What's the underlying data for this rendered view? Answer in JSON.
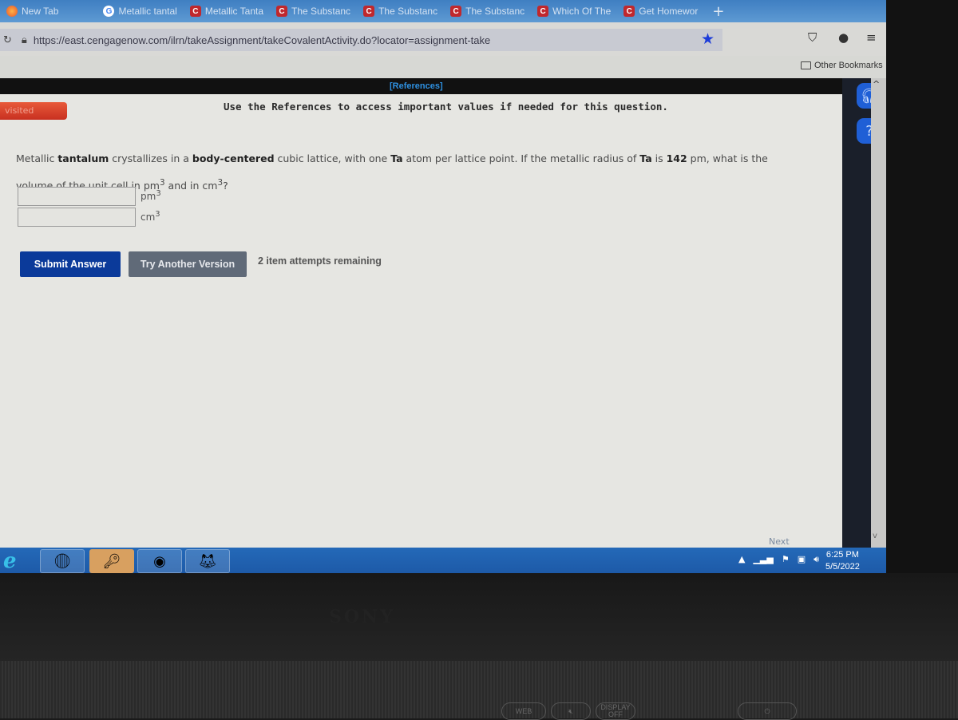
{
  "browser": {
    "tabs": [
      {
        "icon": "firefox-icon",
        "label": "New Tab"
      },
      {
        "icon": "google-icon",
        "label": "Metallic tantal"
      },
      {
        "icon": "cengage-icon",
        "label": "Metallic Tanta"
      },
      {
        "icon": "cengage-icon",
        "label": "The Substanc"
      },
      {
        "icon": "cengage-icon",
        "label": "The Substanc"
      },
      {
        "icon": "cengage-icon",
        "label": "The Substanc"
      },
      {
        "icon": "cengage-icon",
        "label": "Which Of The"
      },
      {
        "icon": "cengage-icon",
        "label": "Get Homewor"
      }
    ],
    "new_tab_label": "+",
    "url": "https://east.cengagenow.com/ilrn/takeAssignment/takeCovalentActivity.do?locator=assignment-take",
    "other_bookmarks": "Other Bookmarks"
  },
  "page": {
    "references_link": "[References]",
    "visited_label": "visited",
    "references_note": "Use the References to access important values if needed for this question.",
    "question": {
      "p1": "Metallic ",
      "b1": "tantalum",
      "p2": " crystallizes in a ",
      "b2": "body-centered",
      "p3": " cubic lattice, with one ",
      "b3": "Ta",
      "p4": " atom per lattice point. If the metallic radius of ",
      "b4": "Ta",
      "p5": " is ",
      "b5": "142",
      "p6": " pm, what is the volume of the unit cell in pm",
      "sup1": "3",
      "p7": " and in cm",
      "sup2": "3",
      "p8": "?"
    },
    "answers": [
      {
        "value": "",
        "unit": "pm",
        "exp": "3"
      },
      {
        "value": "",
        "unit": "cm",
        "exp": "3"
      }
    ],
    "submit_label": "Submit Answer",
    "another_label": "Try Another Version",
    "attempts": "2 item attempts remaining",
    "next_label": "Next"
  },
  "side_panel": {
    "support_icon": "headset-icon",
    "help_icon": "help-icon",
    "help_glyph": "?"
  },
  "taskbar": {
    "time": "6:25 PM",
    "date": "5/5/2022"
  },
  "hardware": {
    "brand": "SONY",
    "web": "WEB",
    "display_off": "DISPLAY OFF"
  },
  "colors": {
    "submit": "#0b3a9a",
    "another": "#606a78",
    "star": "#1c3cd9",
    "references": "#2e90e0",
    "visited": "#d84428",
    "taskbar": "#1d5aa8"
  }
}
